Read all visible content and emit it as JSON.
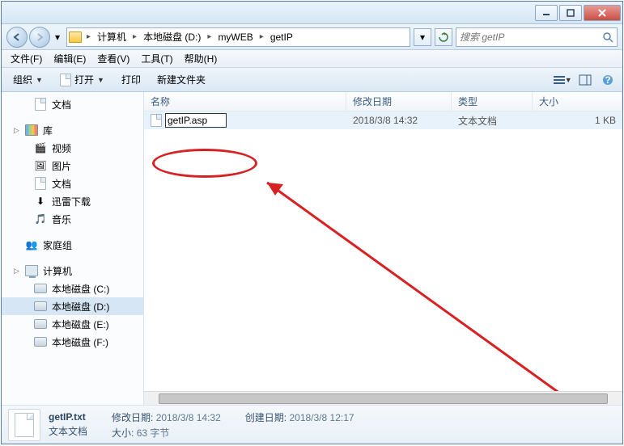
{
  "breadcrumb": {
    "items": [
      "计算机",
      "本地磁盘 (D:)",
      "myWEB",
      "getIP"
    ]
  },
  "search": {
    "placeholder": "搜索 getIP"
  },
  "menubar": {
    "file": "文件(F)",
    "edit": "编辑(E)",
    "view": "查看(V)",
    "tools": "工具(T)",
    "help": "帮助(H)"
  },
  "toolbar": {
    "organize": "组织",
    "open": "打开",
    "print": "打印",
    "newfolder": "新建文件夹"
  },
  "columns": {
    "name": "名称",
    "modified": "修改日期",
    "type": "类型",
    "size": "大小"
  },
  "sidebar": {
    "documents": "文档",
    "libraries": "库",
    "videos": "视频",
    "pictures": "图片",
    "docs2": "文档",
    "thunder": "迅雷下载",
    "music": "音乐",
    "homegroup": "家庭组",
    "computer": "计算机",
    "drive_c": "本地磁盘 (C:)",
    "drive_d": "本地磁盘 (D:)",
    "drive_e": "本地磁盘 (E:)",
    "drive_f": "本地磁盘 (F:)"
  },
  "file": {
    "rename_value": "getIP.asp",
    "modified": "2018/3/8 14:32",
    "type": "文本文档",
    "size": "1 KB"
  },
  "status": {
    "filename": "getIP.txt",
    "filetype": "文本文档",
    "mod_label": "修改日期:",
    "mod_value": "2018/3/8 14:32",
    "created_label": "创建日期:",
    "created_value": "2018/3/8 12:17",
    "size_label": "大小:",
    "size_value": "63 字节"
  }
}
